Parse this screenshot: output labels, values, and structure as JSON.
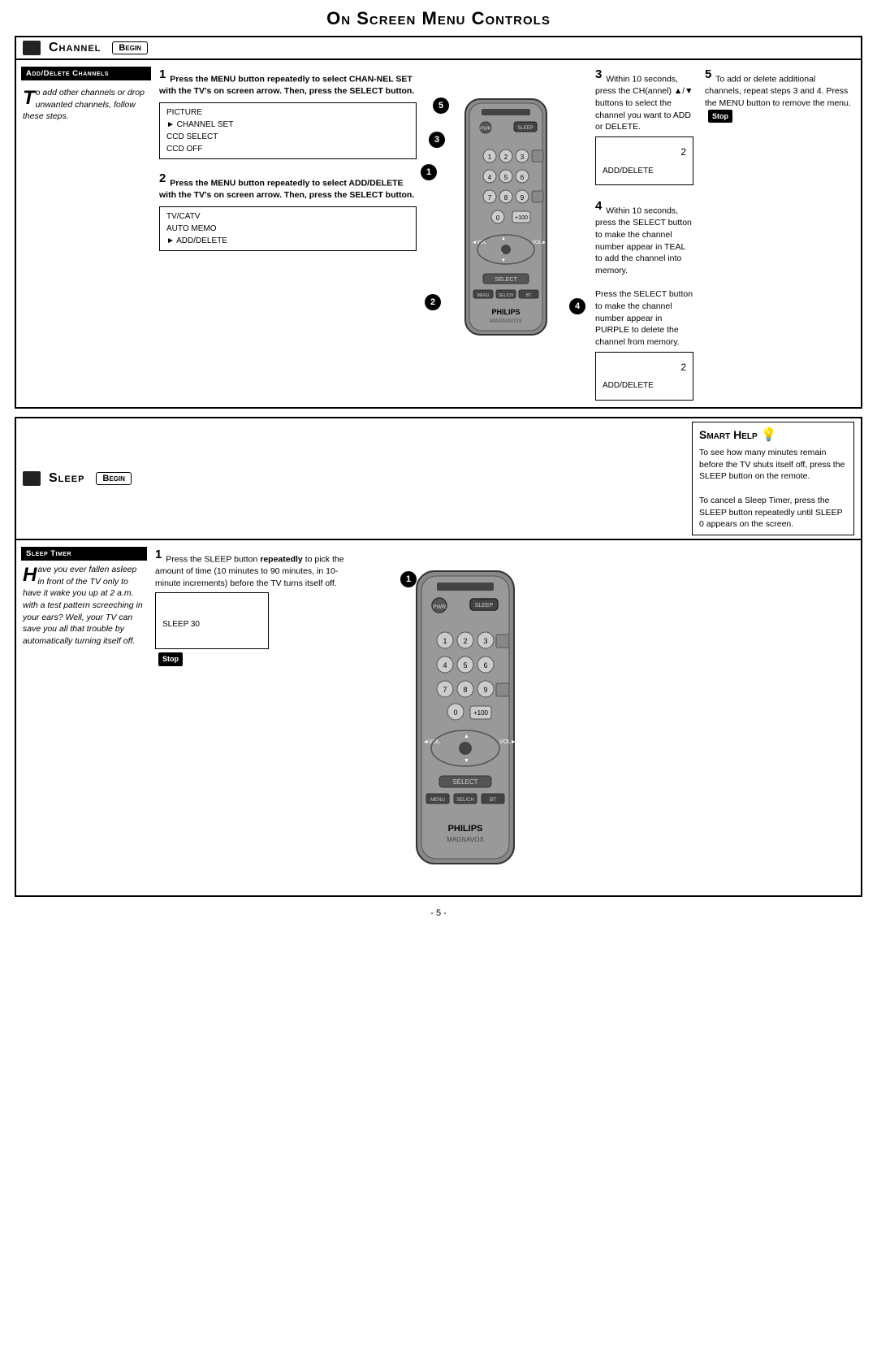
{
  "page": {
    "title": "On Screen Menu Controls",
    "page_number": "- 5 -"
  },
  "channel_section": {
    "icon_label": "CH",
    "title": "Channel",
    "begin_badge": "Begin",
    "sidebar": {
      "label": "Add/Delete Channels",
      "drop_cap": "T",
      "text": "o add other channels or drop unwanted channels, follow these steps."
    },
    "step1": {
      "number": "1",
      "text_bold": "Press the MENU button repeatedly to select CHAN-NEL SET with the TV's on screen arrow. Then, press the SELECT button."
    },
    "step1_menu": {
      "items": [
        "PICTURE",
        "CHANNEL SET",
        "CCD SELECT",
        "CCD OFF"
      ],
      "selected_index": 1
    },
    "step2": {
      "number": "2",
      "text_bold": "Press the MENU button repeatedly to select ADD/DELETE with the TV's on screen arrow. Then, press the SELECT button."
    },
    "step2_menu": {
      "items": [
        "TV/CATV",
        "AUTO MEMO",
        "ADD/DELETE"
      ],
      "selected_index": 2
    },
    "step3": {
      "number": "3",
      "text": "Within 10 seconds, press the CH(annel) ▲/▼ buttons to select the channel you want to ADD or DELETE."
    },
    "step3_screen": {
      "channel_num": "2",
      "label": "ADD/DELETE"
    },
    "step4": {
      "number": "4",
      "text1": "Within 10 seconds, press the SELECT button to make the channel number appear in TEAL to add the channel into memory.",
      "text2": "Press the SELECT button to make the channel number appear in PURPLE to delete the channel from memory."
    },
    "step4_screen": {
      "channel_num": "2",
      "label": "ADD/DELETE"
    },
    "step5": {
      "number": "5",
      "text": "To add or delete additional channels, repeat steps 3 and 4. Press the MENU button to remove the menu.",
      "stop_label": "Stop"
    }
  },
  "sleep_section": {
    "icon_label": "SL",
    "title": "Sleep",
    "begin_badge": "Begin",
    "sidebar": {
      "label": "Sleep Timer",
      "drop_cap": "H",
      "text": "ave you ever fallen asleep in front of the TV only to have it wake you up at 2 a.m. with a test pattern screeching in your ears? Well, your TV can save you all that trouble by automatically turning itself off."
    },
    "step1": {
      "number": "1",
      "text_part1": "Press the SLEEP button",
      "text_bold": "repeatedly",
      "text_part2": "to pick the amount of time (10 minutes to 90 minutes, in 10-minute increments) before the TV turns itself off."
    },
    "step1_screen": {
      "label": "SLEEP 30",
      "stop_label": "Stop"
    },
    "smart_help": {
      "title": "Smart Help",
      "bulb": "💡",
      "text1": "To see how many minutes remain before the TV shuts itself off, press the SLEEP button on the remote.",
      "text2": "To cancel a Sleep Timer, press the SLEEP button repeatedly until SLEEP 0 appears on the screen."
    }
  },
  "remote_callouts_channel": [
    "5",
    "3",
    "1",
    "2",
    "4"
  ],
  "remote_callouts_sleep": [
    "1"
  ]
}
